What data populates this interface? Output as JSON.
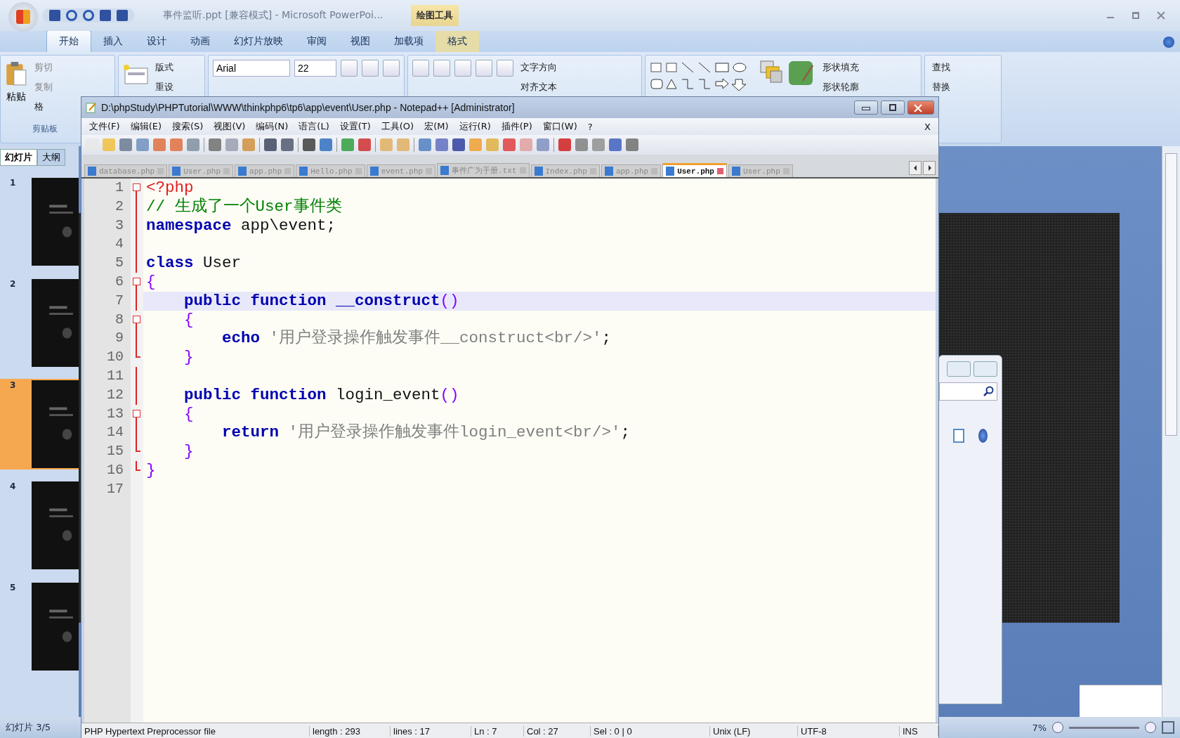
{
  "powerpoint": {
    "title": "事件监听.ppt [兼容模式] - Microsoft PowerPoi...",
    "context_tab": "绘图工具",
    "tabs": [
      {
        "label": "开始",
        "selected": true
      },
      {
        "label": "插入",
        "selected": false
      },
      {
        "label": "设计",
        "selected": false
      },
      {
        "label": "动画",
        "selected": false
      },
      {
        "label": "幻灯片放映",
        "selected": false
      },
      {
        "label": "审阅",
        "selected": false
      },
      {
        "label": "视图",
        "selected": false
      },
      {
        "label": "加载项",
        "selected": false
      },
      {
        "label": "格式",
        "selected": false
      }
    ],
    "ribbon": {
      "paste": "粘贴",
      "cut": "剪切",
      "copy": "复制",
      "format_painter": "格",
      "clipboard_group": "剪贴板",
      "layout": "版式",
      "reset": "重设",
      "font": "Arial",
      "font_size": "22",
      "text_direction": "文字方向",
      "align_text": "对齐文本",
      "shape_fill": "形状填充",
      "shape_outline": "形状轮廓",
      "find": "查找",
      "replace": "替换"
    },
    "panel_tabs": [
      {
        "label": "幻灯片",
        "selected": true
      },
      {
        "label": "大纲",
        "selected": false
      }
    ],
    "slides": [
      {
        "number": "1",
        "selected": false
      },
      {
        "number": "2",
        "selected": false
      },
      {
        "number": "3",
        "selected": true
      },
      {
        "number": "4",
        "selected": false
      },
      {
        "number": "5",
        "selected": false
      }
    ],
    "status": "幻灯片 3/5",
    "zoom": "7%"
  },
  "notepad": {
    "title": "D:\\phpStudy\\PHPTutorial\\WWW\\thinkphp6\\tp6\\app\\event\\User.php - Notepad++ [Administrator]",
    "menu": [
      "文件(F)",
      "编辑(E)",
      "搜索(S)",
      "视图(V)",
      "编码(N)",
      "语言(L)",
      "设置(T)",
      "工具(O)",
      "宏(M)",
      "运行(R)",
      "插件(P)",
      "窗口(W)",
      "?"
    ],
    "close_document": "X",
    "tabs": [
      {
        "label": "database.php",
        "selected": false
      },
      {
        "label": "User.php",
        "selected": false
      },
      {
        "label": "app.php",
        "selected": false
      },
      {
        "label": "Hello.php",
        "selected": false
      },
      {
        "label": "event.php",
        "selected": false
      },
      {
        "label": "事件广为手册.txt",
        "selected": false
      },
      {
        "label": "Index.php",
        "selected": false
      },
      {
        "label": "app.php",
        "selected": false
      },
      {
        "label": "User.php",
        "selected": true
      },
      {
        "label": "User.php",
        "selected": false
      }
    ],
    "lines": [
      {
        "number": "1",
        "fold_start": true,
        "fold_end": false,
        "current": false,
        "tokens": [
          {
            "kind": "tag",
            "text": "<?php"
          }
        ]
      },
      {
        "number": "2",
        "fold_start": false,
        "fold_end": false,
        "current": false,
        "tokens": [
          {
            "kind": "comment",
            "text": "// 生成了一个User事件类"
          }
        ]
      },
      {
        "number": "3",
        "fold_start": false,
        "fold_end": false,
        "current": false,
        "tokens": [
          {
            "kind": "keyword",
            "text": "namespace"
          },
          {
            "kind": "plain",
            "text": " app\\event;"
          }
        ]
      },
      {
        "number": "4",
        "fold_start": false,
        "fold_end": false,
        "current": false
      },
      {
        "number": "5",
        "fold_start": false,
        "fold_end": false,
        "current": false,
        "tokens": [
          {
            "kind": "keyword",
            "text": "class"
          },
          {
            "kind": "plain",
            "text": " User"
          }
        ]
      },
      {
        "number": "6",
        "fold_start": true,
        "fold_end": false,
        "current": false,
        "tokens": [
          {
            "kind": "paren",
            "text": "{"
          }
        ]
      },
      {
        "number": "7",
        "fold_start": false,
        "fold_end": false,
        "current": true,
        "tokens": [
          {
            "kind": "keyword",
            "text": "    public"
          },
          {
            "kind": "keyword",
            "text": " function"
          },
          {
            "kind": "keyword",
            "text": " __construct"
          },
          {
            "kind": "paren",
            "text": "()"
          }
        ]
      },
      {
        "number": "8",
        "fold_start": true,
        "fold_end": false,
        "current": false,
        "tokens": [
          {
            "kind": "paren",
            "text": "    {"
          }
        ]
      },
      {
        "number": "9",
        "fold_start": false,
        "fold_end": false,
        "current": false,
        "tokens": [
          {
            "kind": "keyword",
            "text": "        echo"
          },
          {
            "kind": "string",
            "text": " '用户登录操作触发事件__construct<br/>'"
          },
          {
            "kind": "plain",
            "text": ";"
          }
        ]
      },
      {
        "number": "10",
        "fold_start": false,
        "fold_end": true,
        "current": false,
        "tokens": [
          {
            "kind": "paren",
            "text": "    }"
          }
        ]
      },
      {
        "number": "11",
        "fold_start": false,
        "fold_end": false,
        "current": false
      },
      {
        "number": "12",
        "fold_start": false,
        "fold_end": false,
        "current": false,
        "tokens": [
          {
            "kind": "keyword",
            "text": "    public"
          },
          {
            "kind": "keyword",
            "text": " function"
          },
          {
            "kind": "plain",
            "text": " login_event"
          },
          {
            "kind": "paren",
            "text": "()"
          }
        ]
      },
      {
        "number": "13",
        "fold_start": true,
        "fold_end": false,
        "current": false,
        "tokens": [
          {
            "kind": "paren",
            "text": "    {"
          }
        ]
      },
      {
        "number": "14",
        "fold_start": false,
        "fold_end": false,
        "current": false,
        "tokens": [
          {
            "kind": "keyword",
            "text": "        return"
          },
          {
            "kind": "string",
            "text": " '用户登录操作触发事件login_event<br/>'"
          },
          {
            "kind": "plain",
            "text": ";"
          }
        ]
      },
      {
        "number": "15",
        "fold_start": false,
        "fold_end": true,
        "current": false,
        "tokens": [
          {
            "kind": "paren",
            "text": "    }"
          }
        ]
      },
      {
        "number": "16",
        "fold_start": false,
        "fold_end": true,
        "current": false,
        "tokens": [
          {
            "kind": "paren",
            "text": "}"
          }
        ]
      },
      {
        "number": "17",
        "fold_start": false,
        "fold_end": false,
        "current": false
      }
    ],
    "status": [
      "PHP Hypertext Preprocessor file",
      "length : 293",
      "lines : 17",
      "Ln : 7",
      "Col : 27",
      "Sel : 0 | 0",
      "Unix (LF)",
      "UTF-8",
      "INS"
    ]
  }
}
